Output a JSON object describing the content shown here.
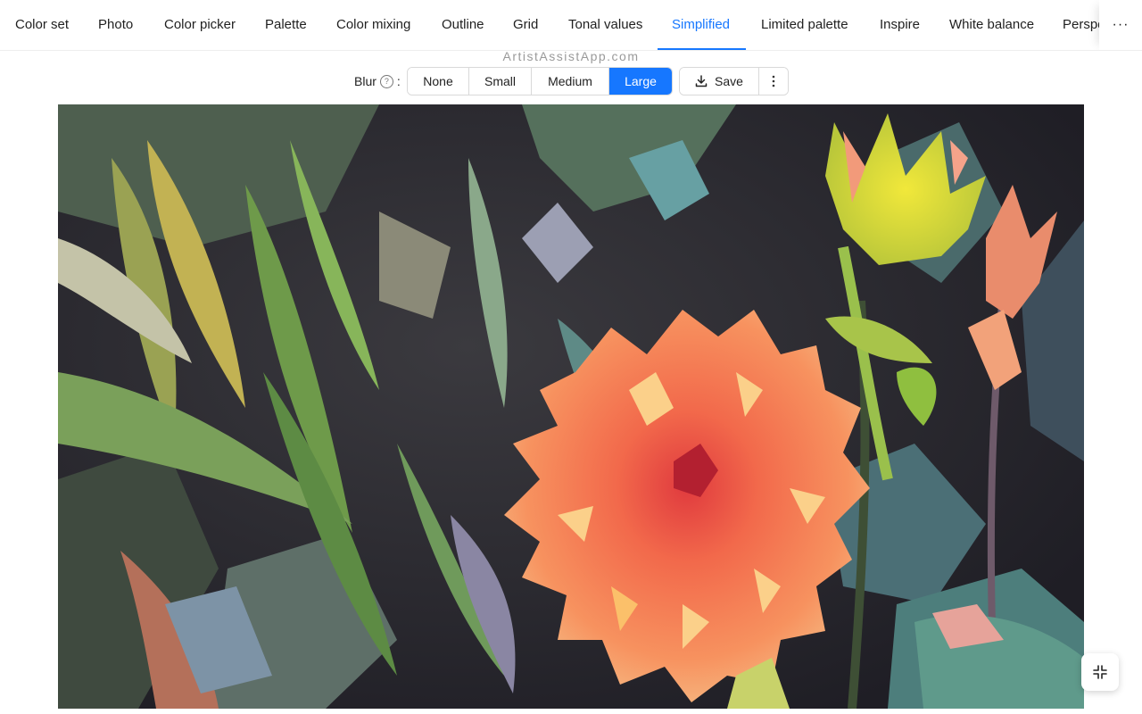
{
  "tabs": [
    {
      "label": "Color set"
    },
    {
      "label": "Photo"
    },
    {
      "label": "Color picker"
    },
    {
      "label": "Palette"
    },
    {
      "label": "Color mixing"
    },
    {
      "label": "Outline"
    },
    {
      "label": "Grid"
    },
    {
      "label": "Tonal values"
    },
    {
      "label": "Simplified"
    },
    {
      "label": "Limited palette"
    },
    {
      "label": "Inspire"
    },
    {
      "label": "White balance"
    },
    {
      "label": "Perspective"
    }
  ],
  "active_tab": "Simplified",
  "more_tabs_glyph": "···",
  "watermark": "ArtistAssistApp.com",
  "toolbar": {
    "blur_label": "Blur",
    "blur_suffix": ":",
    "help_glyph": "?",
    "blur_options": [
      "None",
      "Small",
      "Medium",
      "Large"
    ],
    "blur_selected": "Large",
    "save_label": "Save"
  },
  "icons": {
    "save": "download-icon",
    "kebab": "more-vertical-icon",
    "help": "question-circle-icon",
    "fullscreen": "exit-fullscreen-icon"
  },
  "colors": {
    "accent": "#1677ff",
    "flower": "#f47a55",
    "foliage": "#6f9b4a",
    "background": "#2b2a33"
  }
}
